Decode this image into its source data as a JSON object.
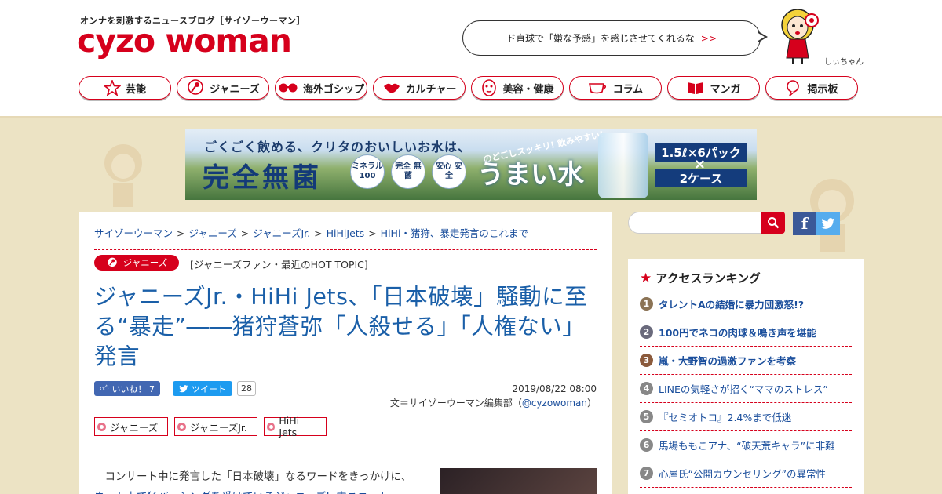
{
  "header": {
    "tagline": "オンナを刺激するニュースブログ［サイゾーウーマン］",
    "logo": "cyzo woman",
    "bubble_text": "ド直球で「嫌な予感」を感じさせてくれるな",
    "bubble_more": ">>",
    "mascot_name": "しぃちゃん"
  },
  "nav": [
    {
      "label": "芸能",
      "icon": "star-icon"
    },
    {
      "label": "ジャニーズ",
      "icon": "microphone-icon"
    },
    {
      "label": "海外ゴシップ",
      "icon": "sunglasses-icon"
    },
    {
      "label": "カルチャー",
      "icon": "lips-icon"
    },
    {
      "label": "美容・健康",
      "icon": "face-mask-icon"
    },
    {
      "label": "コラム",
      "icon": "teacup-icon"
    },
    {
      "label": "マンガ",
      "icon": "book-icon"
    },
    {
      "label": "掲示板",
      "icon": "chat-icon"
    }
  ],
  "banner": {
    "top_line": "ごくごく飲める、クリタのおいしいお水は、",
    "big_text": "完全無菌",
    "badges": [
      "ミネラル 100",
      "完全 無菌",
      "安心 安全"
    ],
    "slogan_small": "のどごしスッキリ! 飲みやすい!",
    "slogan": "うまい水",
    "pack": "1.5ℓ×6パック",
    "times": "×",
    "cases": "2ケース"
  },
  "breadcrumb": [
    "サイゾーウーマン",
    "ジャニーズ",
    "ジャニーズJr.",
    "HiHiJets",
    "HiHi・猪狩、暴走発言のこれまで"
  ],
  "breadcrumb_sep": ">",
  "article": {
    "category": "ジャニーズ",
    "topic": "[ジャニーズファン・最近のHOT TOPIC]",
    "title": "ジャニーズJr.・HiHi Jets、「日本破壊」騒動に至る“暴走”――猪狩蒼弥「人殺せる」「人権ない」発言",
    "fb_like": "いいね！ 7",
    "tweet": "ツイート",
    "tweet_count": "28",
    "date": "2019/08/22 08:00",
    "author_prefix": "文＝サイゾーウーマン編集部（",
    "author_handle": "@cyzowoman",
    "author_suffix": "）",
    "tags": [
      "ジャニーズ",
      "ジャニーズJr.",
      "HiHi Jets"
    ],
    "body_line1": "コンサート中に発言した「日本破壊」なるワードをきっかけに、",
    "body_line2": "ネット上で猛バッシングを受けているジャニーズJr.内ユニット・"
  },
  "sidebar": {
    "ranking_title": "アクセスランキング",
    "ranking": [
      {
        "num": "1",
        "label": "タレントAの結婚に暴力団激怒!?",
        "color": "#8b7355"
      },
      {
        "num": "2",
        "label": "100円でネコの肉球＆鳴き声を堪能",
        "color": "#6a6a7c"
      },
      {
        "num": "3",
        "label": "嵐・大野智の過激ファンを考察",
        "color": "#8b5a3c"
      },
      {
        "num": "4",
        "label": "LINEの気軽さが招く“ママのストレス”",
        "color": "#888888"
      },
      {
        "num": "5",
        "label": "『セミオトコ』2.4%まで低迷",
        "color": "#888888"
      },
      {
        "num": "6",
        "label": "馬場ももこアナ、“破天荒キャラ”に非難",
        "color": "#888888"
      },
      {
        "num": "7",
        "label": "心屋氏“公開カウンセリング”の異常性",
        "color": "#888888"
      }
    ],
    "fb_letter": "f"
  },
  "colors": {
    "accent": "#d6001c",
    "link": "#1a5fa8",
    "background": "#ece3c4"
  }
}
